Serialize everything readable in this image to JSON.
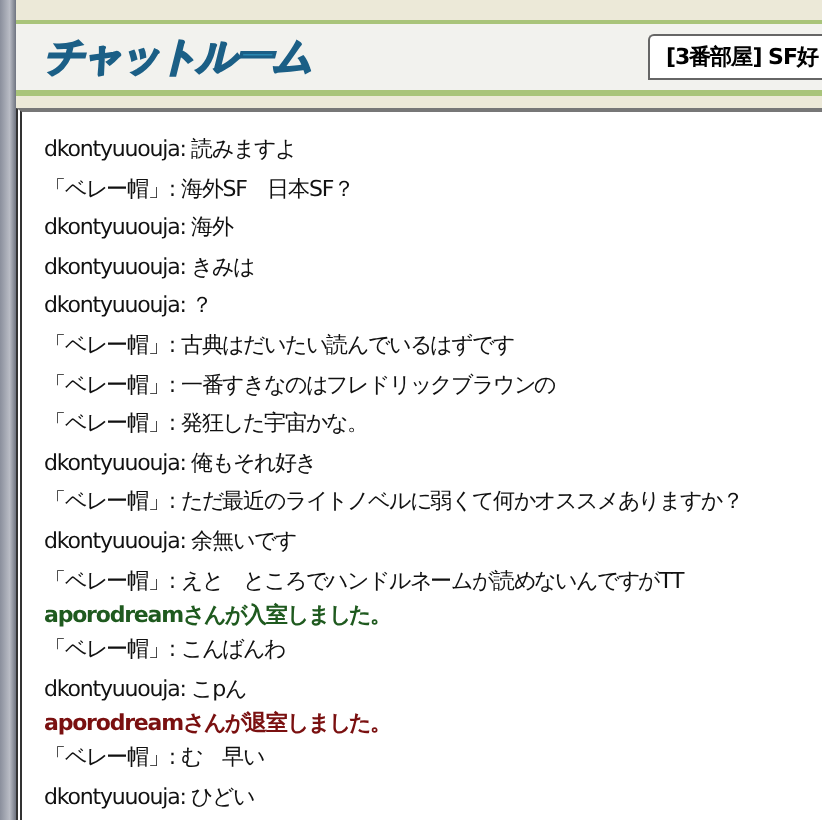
{
  "header": {
    "logo": "チャットルーム",
    "room_title": "[3番部屋] SF好"
  },
  "messages": [
    {
      "kind": "chat",
      "text": "dkontyuuouja: 読みますよ"
    },
    {
      "kind": "chat",
      "text": "「ベレー帽」: 海外SF　日本SF？"
    },
    {
      "kind": "chat",
      "text": "dkontyuuouja: 海外"
    },
    {
      "kind": "chat",
      "text": "dkontyuuouja: きみは"
    },
    {
      "kind": "chat",
      "text": "dkontyuuouja: ？"
    },
    {
      "kind": "chat",
      "text": "「ベレー帽」: 古典はだいたい読んでいるはずです"
    },
    {
      "kind": "chat",
      "text": "「ベレー帽」: 一番すきなのはフレドリックブラウンの"
    },
    {
      "kind": "chat",
      "text": "「ベレー帽」: 発狂した宇宙かな。"
    },
    {
      "kind": "chat",
      "text": "dkontyuuouja: 俺もそれ好き"
    },
    {
      "kind": "chat",
      "text": "「ベレー帽」: ただ最近のライトノベルに弱くて何かオススメありますか？"
    },
    {
      "kind": "chat",
      "text": "dkontyuuouja: 余無いです"
    },
    {
      "kind": "chat",
      "text": "「ベレー帽」: えと　ところでハンドルネームが読めないんですがTT"
    },
    {
      "kind": "join",
      "text": "aporodreamさんが入室しました。"
    },
    {
      "kind": "chat",
      "text": "「ベレー帽」: こんばんわ"
    },
    {
      "kind": "chat",
      "text": "dkontyuuouja: こpん"
    },
    {
      "kind": "leave",
      "text": "aporodreamさんが退室しました。"
    },
    {
      "kind": "chat",
      "text": "「ベレー帽」: む　早い"
    },
    {
      "kind": "chat",
      "text": "dkontyuuouja: ひどい"
    }
  ]
}
